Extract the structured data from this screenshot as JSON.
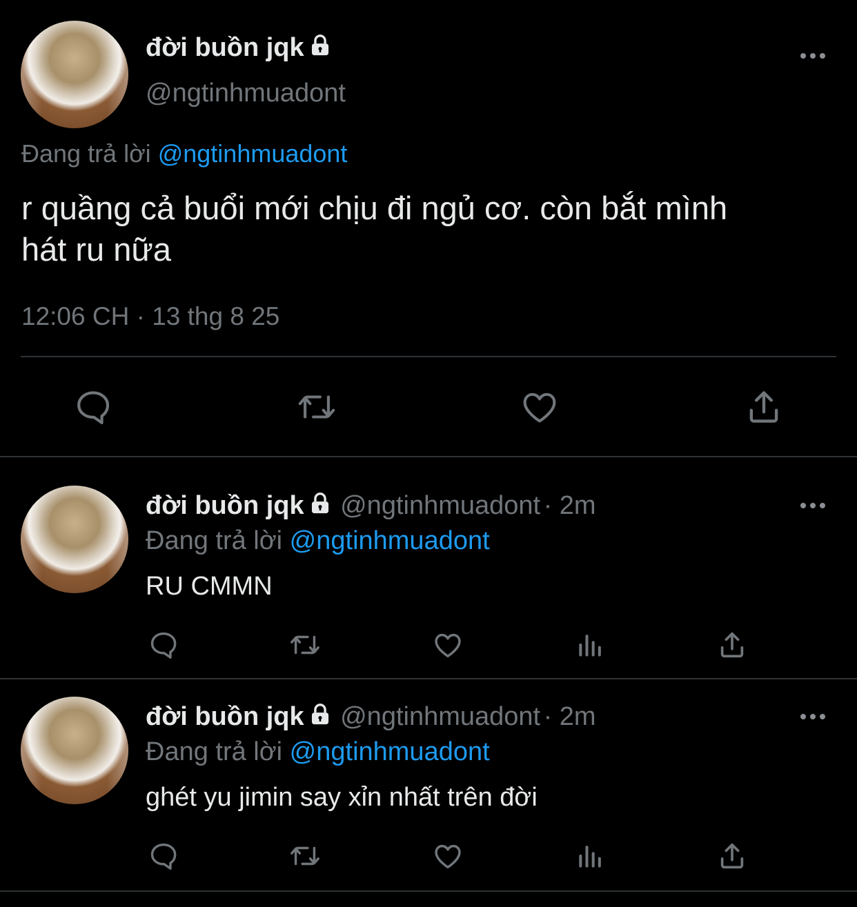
{
  "main_tweet": {
    "display_name": "đời buồn jqk",
    "handle": "@ngtinhmuadont",
    "reply_prefix": "Đang trả lời",
    "reply_to": "@ngtinhmuadont",
    "text_line1": "r quầng cả buổi mới chịu đi ngủ cơ. còn bắt mình",
    "text_line2": "hát ru nữa",
    "timestamp": "12:06 CH · 13 thg 8 25",
    "actions": [
      "reply-icon",
      "retweet-icon",
      "like-icon",
      "share-icon"
    ]
  },
  "replies": [
    {
      "display_name": "đời buồn jqk",
      "handle": "@ngtinhmuadont",
      "time": "· 2m",
      "reply_prefix": "Đang trả lời",
      "reply_to": "@ngtinhmuadont",
      "text": "RU CMMN",
      "actions": [
        "reply-icon",
        "retweet-icon",
        "like-icon",
        "views-icon",
        "share-icon"
      ]
    },
    {
      "display_name": "đời buồn jqk",
      "handle": "@ngtinhmuadont",
      "time": "· 2m",
      "reply_prefix": "Đang trả lời",
      "reply_to": "@ngtinhmuadont",
      "text": "ghét yu jimin say xỉn nhất trên đời",
      "actions": [
        "reply-icon",
        "retweet-icon",
        "like-icon",
        "views-icon",
        "share-icon"
      ]
    }
  ],
  "colors": {
    "background": "#000000",
    "text": "#e7e9ea",
    "secondary": "#71767b",
    "link": "#1d9bf0",
    "divider": "#2f3336"
  }
}
